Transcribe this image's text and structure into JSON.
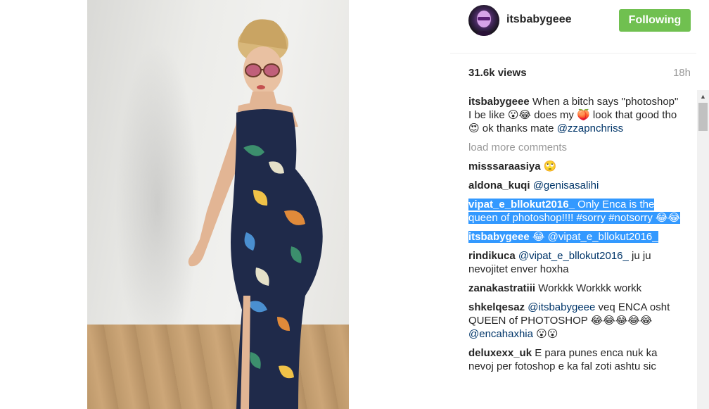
{
  "post": {
    "username": "itsbabygeee",
    "follow_button": "Following",
    "views": "31.6k views",
    "time_ago": "18h"
  },
  "caption": {
    "user": "itsbabygeee",
    "text": "When a bitch says \"photoshop\" I be like 😮😂 does my 🍑 look that good tho 😍 ok thanks mate",
    "mention": "@zzapnchriss"
  },
  "load_more": "load more comments",
  "comments": [
    {
      "user": "misssaraasiya",
      "text": "🙄",
      "mention": "",
      "selected": false
    },
    {
      "user": "aldona_kuqi",
      "text": "",
      "mention": "@genisasalihi",
      "selected": false
    },
    {
      "user": "vipat_e_bllokut2016_",
      "text": "Only Enca is the queen of photoshop!!!! #sorry #notsorry 😂😂",
      "mention": "",
      "selected": true
    },
    {
      "user": "itsbabygeee",
      "text": "😂",
      "mention": "@vipat_e_bllokut2016_",
      "selected": true
    },
    {
      "user": "rindikuca",
      "text": "ju ju nevojitet enver hoxha",
      "mention": "@vipat_e_bllokut2016_",
      "selected": false
    },
    {
      "user": "zanakastratiii",
      "text": "Workkk Workkk workk",
      "mention": "",
      "selected": false
    },
    {
      "user": "shkelqesaz",
      "text": "veq ENCA osht QUEEN of PHOTOSHOP 😂😂😂😂😂",
      "mention": "@itsbabygeee",
      "mention2": "@encahaxhia",
      "tail": "😮😮",
      "selected": false
    },
    {
      "user": "deluxexx_uk",
      "text": "E para punes enca nuk ka nevoj per fotoshop e ka fal zoti ashtu sic",
      "mention": "",
      "selected": false
    }
  ],
  "icons": {
    "avatar": "profile-avatar",
    "scroll_up": "scroll-up-arrow-icon"
  },
  "colors": {
    "follow_green": "#70c050",
    "mention_blue": "#003569",
    "selection_blue": "#3399ff",
    "muted_gray": "#999999"
  }
}
